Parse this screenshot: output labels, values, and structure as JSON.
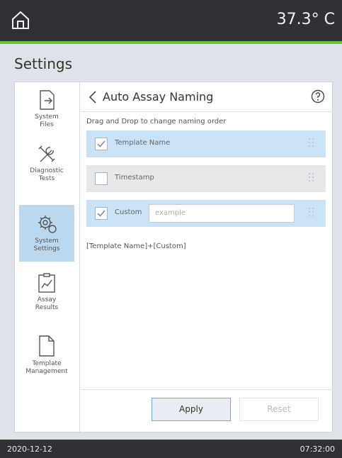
{
  "topbar": {
    "temperature": "37.3° C"
  },
  "page": {
    "title": "Settings"
  },
  "sidebar": {
    "items": [
      {
        "label": "System\nFiles",
        "icon": "file-arrow-icon"
      },
      {
        "label": "Diagnostic\nTests",
        "icon": "tools-icon"
      },
      {
        "label": "System\nSettings",
        "icon": "gear-settings-icon",
        "active": true
      },
      {
        "label": "Assay\nResults",
        "icon": "clipboard-chart-icon"
      },
      {
        "label": "Template\nManagement",
        "icon": "document-icon"
      }
    ]
  },
  "main": {
    "title": "Auto Assay Naming",
    "instructions": "Drag and Drop to change naming order",
    "rows": [
      {
        "label": "Template Name",
        "checked": true
      },
      {
        "label": "Timestamp",
        "checked": false
      },
      {
        "label": "Custom",
        "checked": true
      }
    ],
    "custom_placeholder": "example",
    "preview": "[Template Name]+[Custom]",
    "apply_label": "Apply",
    "reset_label": "Reset"
  },
  "statusbar": {
    "date": "2020-12-12",
    "time": "07:32:00"
  },
  "colors": {
    "accent": "#6cbf3a",
    "selection": "#c9e2f5",
    "active_nav": "#bcd8ee"
  }
}
